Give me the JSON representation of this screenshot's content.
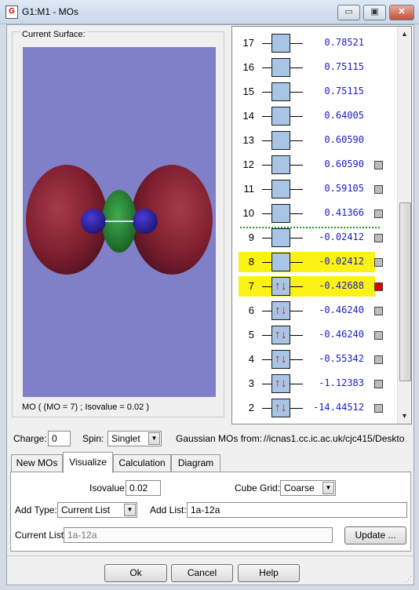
{
  "window": {
    "title": "G1:M1 - MOs",
    "icon_text": "G",
    "buttons": {
      "minimize": "▭",
      "maximize": "▣",
      "close": "✕"
    }
  },
  "surface": {
    "group_label": "Current Surface:",
    "caption": "MO ( (MO = 7) ; Isovalue = 0.02 )",
    "background_color": "#8080c8"
  },
  "orbitals": [
    {
      "index": "17",
      "energy": "0.78521",
      "occupied": false,
      "highlighted": false,
      "marker": ""
    },
    {
      "index": "16",
      "energy": "0.75115",
      "occupied": false,
      "highlighted": false,
      "marker": ""
    },
    {
      "index": "15",
      "energy": "0.75115",
      "occupied": false,
      "highlighted": false,
      "marker": ""
    },
    {
      "index": "14",
      "energy": "0.64005",
      "occupied": false,
      "highlighted": false,
      "marker": ""
    },
    {
      "index": "13",
      "energy": "0.60590",
      "occupied": false,
      "highlighted": false,
      "marker": ""
    },
    {
      "index": "12",
      "energy": "0.60590",
      "occupied": false,
      "highlighted": false,
      "marker": "gray"
    },
    {
      "index": "11",
      "energy": "0.59105",
      "occupied": false,
      "highlighted": false,
      "marker": "gray"
    },
    {
      "index": "10",
      "energy": "0.41366",
      "occupied": false,
      "highlighted": false,
      "marker": "gray"
    },
    {
      "index": "9",
      "energy": "-0.02412",
      "occupied": false,
      "highlighted": false,
      "marker": "gray"
    },
    {
      "index": "8",
      "energy": "-0.02412",
      "occupied": false,
      "highlighted": true,
      "marker": "gray"
    },
    {
      "index": "7",
      "energy": "-0.42688",
      "occupied": true,
      "highlighted": true,
      "marker": "red"
    },
    {
      "index": "6",
      "energy": "-0.46240",
      "occupied": true,
      "highlighted": false,
      "marker": "gray"
    },
    {
      "index": "5",
      "energy": "-0.46240",
      "occupied": true,
      "highlighted": false,
      "marker": "gray"
    },
    {
      "index": "4",
      "energy": "-0.55342",
      "occupied": true,
      "highlighted": false,
      "marker": "gray"
    },
    {
      "index": "3",
      "energy": "-1.12383",
      "occupied": true,
      "highlighted": false,
      "marker": "gray"
    },
    {
      "index": "2",
      "energy": "-14.44512",
      "occupied": true,
      "highlighted": false,
      "marker": "gray"
    }
  ],
  "colors": {
    "energy_text": "#1b1bd0",
    "highlight": "#fbf215",
    "selected_marker": "#e00000",
    "homo_lumo_divider": "#1c9b1c",
    "level_box": "#a9c5e5"
  },
  "charge": {
    "label": "Charge:",
    "value": "0"
  },
  "spin": {
    "label": "Spin:",
    "value": "Singlet"
  },
  "source": {
    "label": "Gaussian MOs from:",
    "path": "//icnas1.cc.ic.ac.uk/cjc415/Deskto"
  },
  "tabs": [
    {
      "label": "New MOs",
      "active": false
    },
    {
      "label": "Visualize",
      "active": true
    },
    {
      "label": "Calculation",
      "active": false
    },
    {
      "label": "Diagram",
      "active": false
    }
  ],
  "visualize": {
    "isovalue_label": "Isovalue:",
    "isovalue": "0.02",
    "cube_grid_label": "Cube Grid:",
    "cube_grid": "Coarse",
    "add_type_label": "Add Type:",
    "add_type": "Current List",
    "add_list_label": "Add List:",
    "add_list": "1a-12a",
    "current_list_label": "Current List:",
    "current_list": "1a-12a",
    "update_button": "Update ..."
  },
  "footer": {
    "ok": "Ok",
    "cancel": "Cancel",
    "help": "Help"
  },
  "scrollbar": {
    "position": 0.6
  }
}
